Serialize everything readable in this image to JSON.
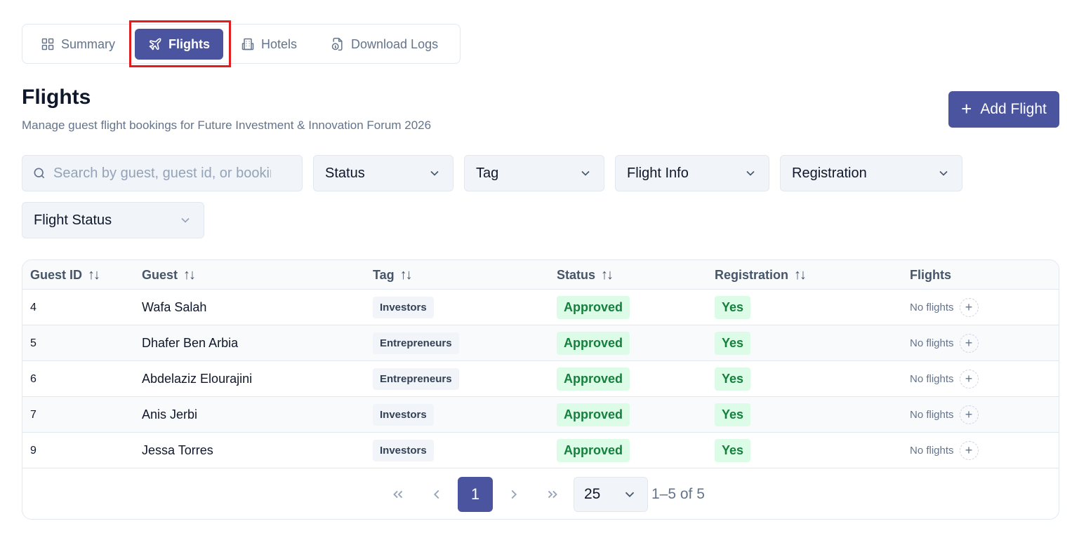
{
  "tabs": [
    {
      "label": "Summary",
      "icon": "grid-icon"
    },
    {
      "label": "Flights",
      "icon": "plane-icon",
      "active": true
    },
    {
      "label": "Hotels",
      "icon": "hotel-icon"
    },
    {
      "label": "Download Logs",
      "icon": "file-download-icon"
    }
  ],
  "header": {
    "title": "Flights",
    "subtitle": "Manage guest flight bookings for Future Investment & Innovation Forum 2026",
    "add_button": "Add Flight"
  },
  "filters": {
    "search_placeholder": "Search by guest, guest id, or booking",
    "status": "Status",
    "tag": "Tag",
    "flight_info": "Flight Info",
    "registration": "Registration",
    "flight_status": "Flight Status"
  },
  "table": {
    "columns": [
      "Guest ID",
      "Guest",
      "Tag",
      "Status",
      "Registration",
      "Flights"
    ],
    "rows": [
      {
        "id": "4",
        "guest": "Wafa Salah",
        "tag": "Investors",
        "status": "Approved",
        "registration": "Yes",
        "flights": "No flights"
      },
      {
        "id": "5",
        "guest": "Dhafer Ben Arbia",
        "tag": "Entrepreneurs",
        "status": "Approved",
        "registration": "Yes",
        "flights": "No flights"
      },
      {
        "id": "6",
        "guest": "Abdelaziz Elourajini",
        "tag": "Entrepreneurs",
        "status": "Approved",
        "registration": "Yes",
        "flights": "No flights"
      },
      {
        "id": "7",
        "guest": "Anis Jerbi",
        "tag": "Investors",
        "status": "Approved",
        "registration": "Yes",
        "flights": "No flights"
      },
      {
        "id": "9",
        "guest": "Jessa Torres",
        "tag": "Investors",
        "status": "Approved",
        "registration": "Yes",
        "flights": "No flights"
      }
    ]
  },
  "pagination": {
    "current_page": "1",
    "page_size": "25",
    "range": "1–5 of 5"
  },
  "colors": {
    "accent": "#4a549f",
    "approved_bg": "#dcfce7",
    "approved_text": "#15803d",
    "highlight_border": "#e11d1d"
  }
}
